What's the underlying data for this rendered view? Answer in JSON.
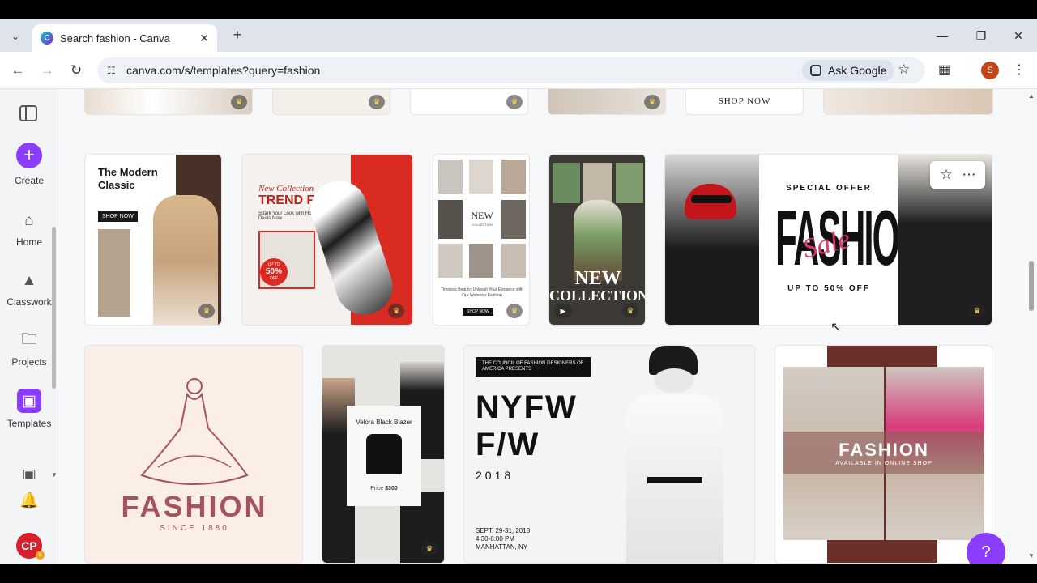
{
  "browser": {
    "tab_title": "Search fashion - Canva",
    "favicon_letter": "C",
    "url": "canva.com/s/templates?query=fashion",
    "ask_google": "Ask Google",
    "profile_initial": "S"
  },
  "sidebar": {
    "create": "Create",
    "items": [
      {
        "label": "Home",
        "icon": "home-icon"
      },
      {
        "label": "Classwork",
        "icon": "mortarboard-icon"
      },
      {
        "label": "Projects",
        "icon": "folder-icon"
      },
      {
        "label": "Templates",
        "icon": "templates-icon"
      }
    ],
    "avatar_initials": "CP",
    "avatar_badge": "s"
  },
  "templates": {
    "top_strip_text": "SHOP NOW",
    "modern_classic": {
      "title": "The Modern Classic",
      "cta": "SHOP NOW"
    },
    "trend_fashion": {
      "kicker": "New Collection",
      "title": "TREND FASHION",
      "sub": "Spark Your Look with Hot Deals Now",
      "badge_top": "UP TO",
      "badge_pct": "50%",
      "badge_bottom": "OFF"
    },
    "new_collection_grid": {
      "title": "NEW",
      "sub": "COLLECTION",
      "tagline": "Timeless Beauty: Unleash Your Elegance with Our Women's Fashion",
      "cta": "SHOP NOW"
    },
    "new_collection_video": {
      "line1": "NEW",
      "line2": "COLLECTION"
    },
    "special_offer": {
      "kicker": "SPECIAL OFFER",
      "title": "FASHION",
      "script": "Sale",
      "footer": "UP TO 50% OFF"
    },
    "fashion_logo": {
      "title": "FASHION",
      "sub": "SINCE 1880"
    },
    "blazer": {
      "label": "Velora Black Blazer",
      "price_label": "Price",
      "price": "$300"
    },
    "nyfw": {
      "banner": "THE COUNCIL OF FASHION DESIGNERS OF AMERICA PRESENTS",
      "line1": "NYFW",
      "line2": "F/W",
      "year": "2018",
      "dates": "SEPT. 29-31, 2018",
      "time": "4:30-6:00 PM",
      "place": "MANHATTAN, NY"
    },
    "fashion_shop": {
      "title": "FASHION",
      "sub": "AVAILABLE IN ONLINE SHOP"
    }
  },
  "help": "?"
}
